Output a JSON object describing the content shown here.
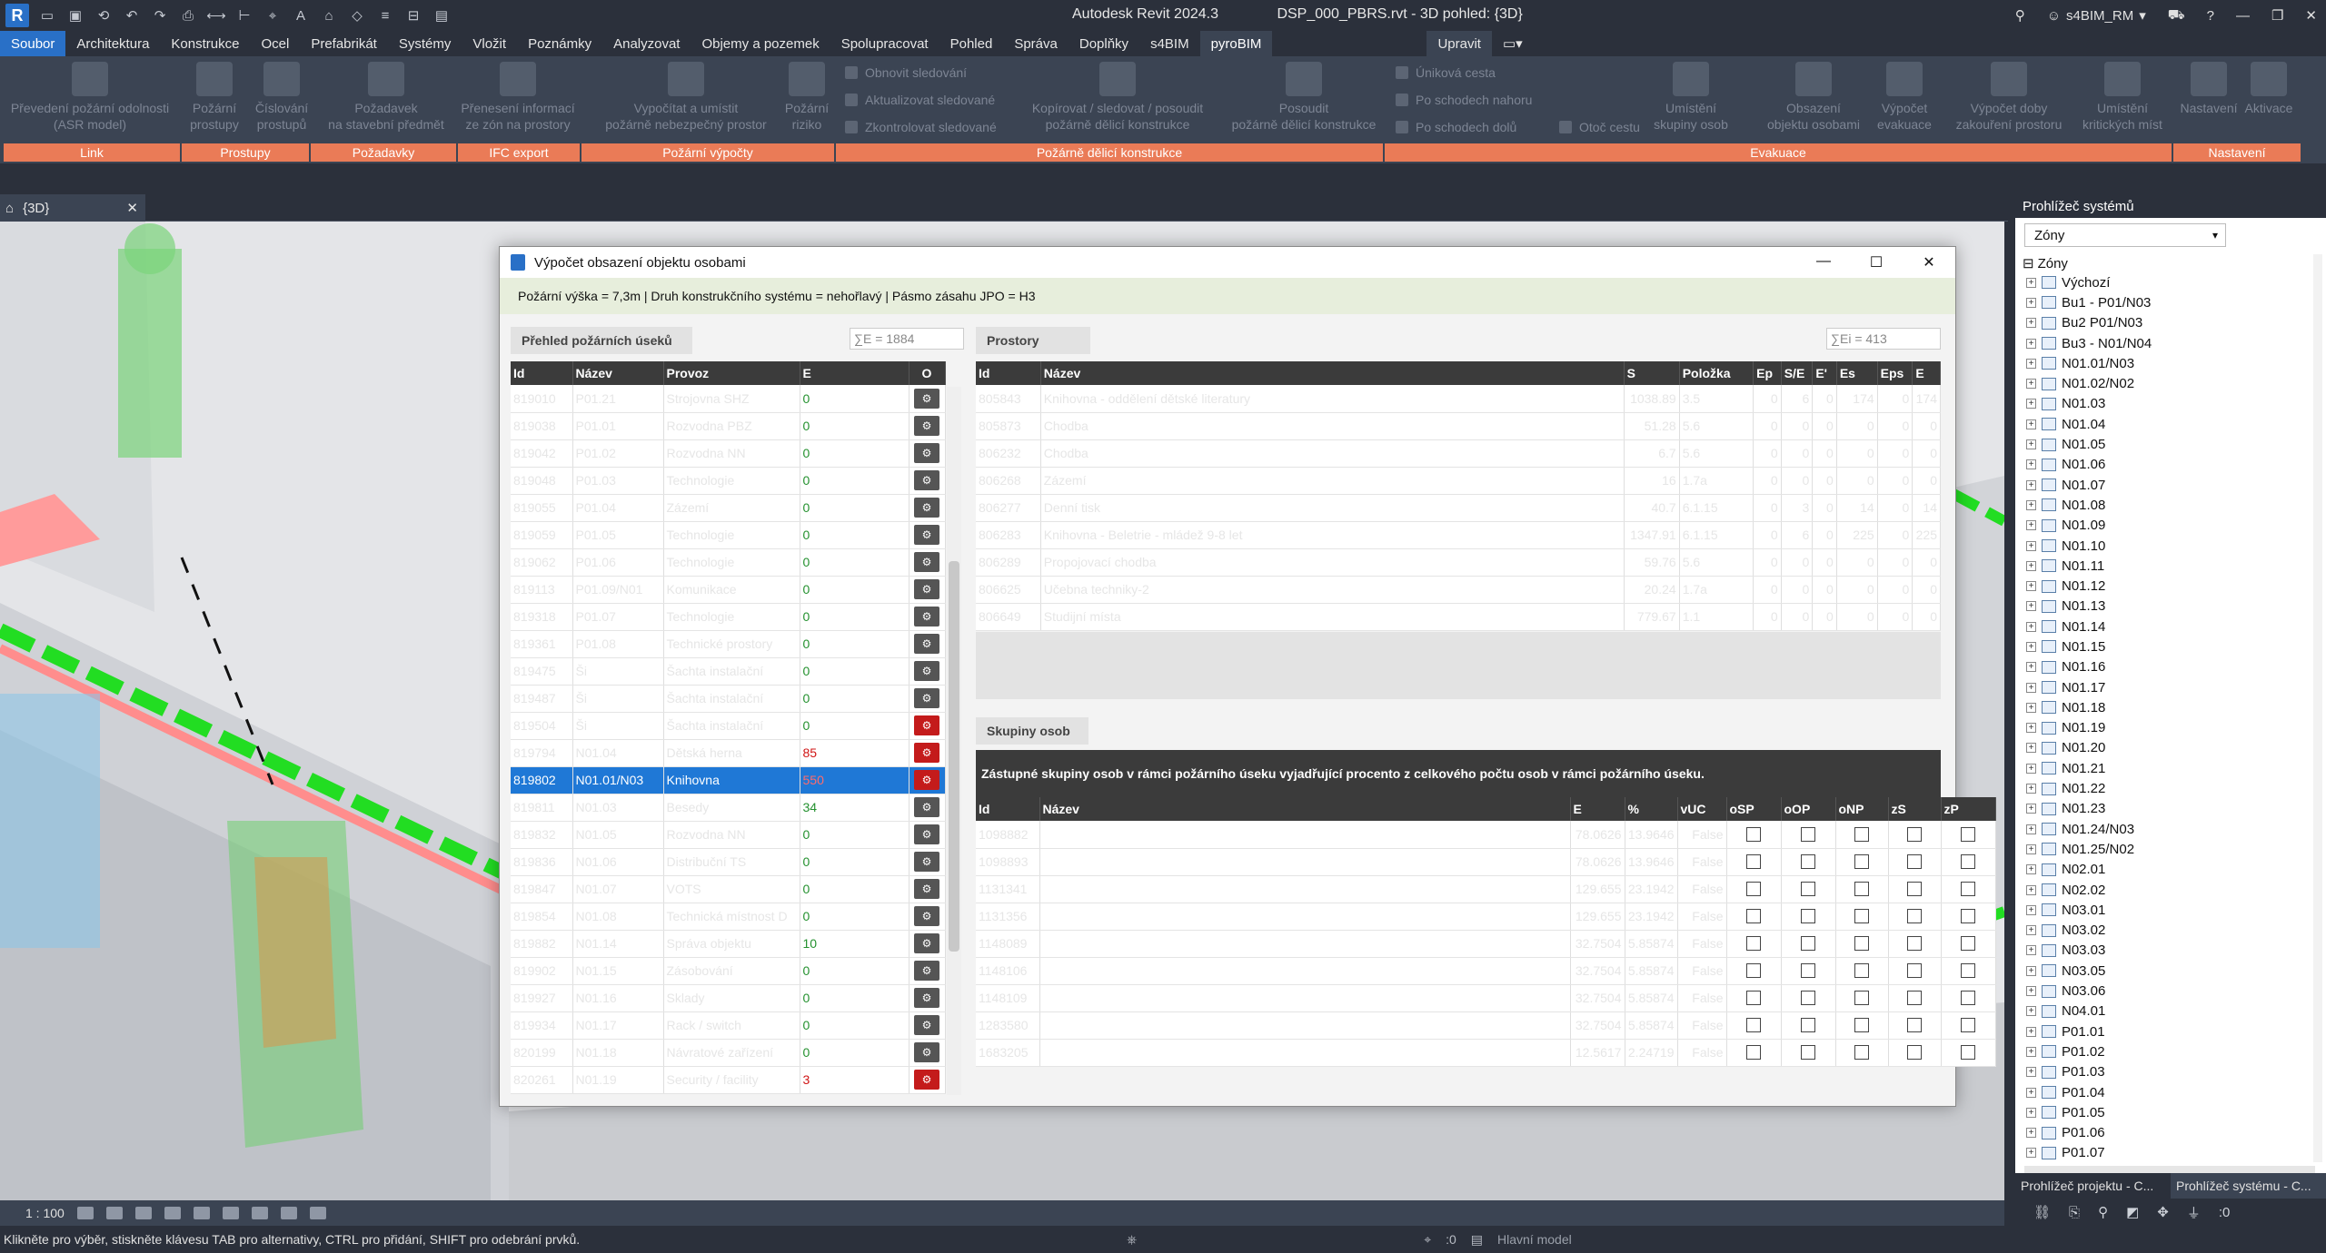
{
  "window": {
    "app_title": "Autodesk Revit 2024.3",
    "doc_title": "DSP_000_PBRS.rvt - 3D pohled: {3D}",
    "user": "s4BIM_RM",
    "logo": "R"
  },
  "ribbon_tabs": [
    "Soubor",
    "Architektura",
    "Konstrukce",
    "Ocel",
    "Prefabrikát",
    "Systémy",
    "Vložit",
    "Poznámky",
    "Analyzovat",
    "Objemy a pozemek",
    "Spolupracovat",
    "Pohled",
    "Správa",
    "Doplňky",
    "s4BIM",
    "pyroBIM"
  ],
  "context_tab": "Upravit",
  "ribbon_buttons": [
    {
      "label": "Převedení požární odolnosti\n(ASR model)"
    },
    {
      "label": "Požární\nprostupy"
    },
    {
      "label": "Číslování\nprostupů"
    },
    {
      "label": "Požadavek\nna stavební předmět"
    },
    {
      "label": "Přenesení informací\nze zón na prostory"
    },
    {
      "label": "Vypočítat a umístit\npožárně nebezpečný prostor"
    },
    {
      "label": "Požární\nriziko"
    },
    {
      "label": "Kopírovat / sledovat / posoudit\npožárně dělicí konstrukce"
    },
    {
      "label": "Posoudit\npožárně dělicí konstrukce"
    },
    {
      "label": "Umístění\nskupiny osob"
    },
    {
      "label": "Obsazení\nobjektu osobami"
    },
    {
      "label": "Výpočet\nevakuace"
    },
    {
      "label": "Výpočet doby\nzakouření prostoru"
    },
    {
      "label": "Umístění\nkritických míst"
    },
    {
      "label": "Nastavení"
    },
    {
      "label": "Aktivace"
    }
  ],
  "ribbon_small": [
    "Obnovit sledování",
    "Aktualizovat sledované",
    "Zkontrolovat sledované",
    "Úniková cesta",
    "Po schodech nahoru",
    "Po schodech dolů",
    "Otoč cestu"
  ],
  "ribbon_panels": [
    "Link",
    "Prostupy",
    "Požadavky",
    "IFC export",
    "Požární výpočty",
    "Požárně dělicí konstrukce",
    "Evakuace",
    "Nastavení"
  ],
  "view_tab": {
    "label": "{3D}",
    "close": "✕"
  },
  "view_bar": {
    "scale": "1 : 100"
  },
  "status_bar": {
    "message": "Klikněte pro výběr, stiskněte klávesu TAB pro alternativy, CTRL pro přidání, SHIFT pro odebrání prvků.",
    "coord": ":0",
    "model": "Hlavní model",
    "filter": ":0"
  },
  "system_browser": {
    "title": "Prohlížeč systémů",
    "selected": "Zóny",
    "root": "Zóny",
    "items": [
      "Výchozí",
      "Bu1 - P01/N03",
      "Bu2 P01/N03",
      "Bu3 - N01/N04",
      "N01.01/N03",
      "N01.02/N02",
      "N01.03",
      "N01.04",
      "N01.05",
      "N01.06",
      "N01.07",
      "N01.08",
      "N01.09",
      "N01.10",
      "N01.11",
      "N01.12",
      "N01.13",
      "N01.14",
      "N01.15",
      "N01.16",
      "N01.17",
      "N01.18",
      "N01.19",
      "N01.20",
      "N01.21",
      "N01.22",
      "N01.23",
      "N01.24/N03",
      "N01.25/N02",
      "N02.01",
      "N02.02",
      "N03.01",
      "N03.02",
      "N03.03",
      "N03.05",
      "N03.06",
      "N04.01",
      "P01.01",
      "P01.02",
      "P01.03",
      "P01.04",
      "P01.05",
      "P01.06",
      "P01.07"
    ],
    "bottom_tabs": [
      "Prohlížeč projektu - C...",
      "Prohlížeč systému - C..."
    ]
  },
  "dialog": {
    "title": "Výpočet obsazení objektu osobami",
    "info": "Požární výška = 7,3m | Druh konstrukčního systému = nehořlavý | Pásmo zásahu JPO = H3",
    "fire_sections": {
      "title": "Přehled požárních úseků",
      "sum": "∑E = 1884",
      "columns": [
        "Id",
        "Název",
        "Provoz",
        "E",
        "O"
      ],
      "rows": [
        {
          "id": "819010",
          "name": "P01.21",
          "use": "Strojovna SHZ",
          "e": "0",
          "flag": "ok"
        },
        {
          "id": "819038",
          "name": "P01.01",
          "use": "Rozvodna PBZ",
          "e": "0",
          "flag": "ok"
        },
        {
          "id": "819042",
          "name": "P01.02",
          "use": "Rozvodna NN",
          "e": "0",
          "flag": "ok"
        },
        {
          "id": "819048",
          "name": "P01.03",
          "use": "Technologie",
          "e": "0",
          "flag": "ok"
        },
        {
          "id": "819055",
          "name": "P01.04",
          "use": "Zázemí",
          "e": "0",
          "flag": "ok"
        },
        {
          "id": "819059",
          "name": "P01.05",
          "use": "Technologie",
          "e": "0",
          "flag": "ok"
        },
        {
          "id": "819062",
          "name": "P01.06",
          "use": "Technologie",
          "e": "0",
          "flag": "ok"
        },
        {
          "id": "819113",
          "name": "P01.09/N01",
          "use": "Komunikace",
          "e": "0",
          "flag": "ok"
        },
        {
          "id": "819318",
          "name": "P01.07",
          "use": "Technologie",
          "e": "0",
          "flag": "ok"
        },
        {
          "id": "819361",
          "name": "P01.08",
          "use": "Technické prostory",
          "e": "0",
          "flag": "ok"
        },
        {
          "id": "819475",
          "name": "Ši",
          "use": "Šachta instalační",
          "e": "0",
          "flag": "ok"
        },
        {
          "id": "819487",
          "name": "Ši",
          "use": "Šachta instalační",
          "e": "0",
          "flag": "ok"
        },
        {
          "id": "819504",
          "name": "Ši",
          "use": "Šachta instalační",
          "e": "0",
          "flag": "warn"
        },
        {
          "id": "819794",
          "name": "N01.04",
          "use": "Dětská herna",
          "e": "85",
          "flag": "warn"
        },
        {
          "id": "819802",
          "name": "N01.01/N03",
          "use": "Knihovna",
          "e": "550",
          "flag": "warn",
          "selected": true
        },
        {
          "id": "819811",
          "name": "N01.03",
          "use": "Besedy",
          "e": "34",
          "flag": "ok"
        },
        {
          "id": "819832",
          "name": "N01.05",
          "use": "Rozvodna NN",
          "e": "0",
          "flag": "ok"
        },
        {
          "id": "819836",
          "name": "N01.06",
          "use": "Distribuční TS",
          "e": "0",
          "flag": "ok"
        },
        {
          "id": "819847",
          "name": "N01.07",
          "use": "VOTS",
          "e": "0",
          "flag": "ok"
        },
        {
          "id": "819854",
          "name": "N01.08",
          "use": "Technická místnost D",
          "e": "0",
          "flag": "ok"
        },
        {
          "id": "819882",
          "name": "N01.14",
          "use": "Správa objektu",
          "e": "10",
          "flag": "ok"
        },
        {
          "id": "819902",
          "name": "N01.15",
          "use": "Zásobování",
          "e": "0",
          "flag": "ok"
        },
        {
          "id": "819927",
          "name": "N01.16",
          "use": "Sklady",
          "e": "0",
          "flag": "ok"
        },
        {
          "id": "819934",
          "name": "N01.17",
          "use": "Rack / switch",
          "e": "0",
          "flag": "ok"
        },
        {
          "id": "820199",
          "name": "N01.18",
          "use": "Návratové zařízení",
          "e": "0",
          "flag": "ok"
        },
        {
          "id": "820261",
          "name": "N01.19",
          "use": "Security / facility",
          "e": "3",
          "flag": "warn"
        }
      ]
    },
    "spaces": {
      "title": "Prostory",
      "sum": "∑Ei = 413",
      "columns": [
        "Id",
        "Název",
        "S",
        "Položka",
        "Ep",
        "S/E",
        "E'",
        "Es",
        "Eps",
        "E"
      ],
      "rows": [
        [
          "805843",
          "Knihovna - oddělení dětské literatury",
          "1038.89",
          "3.5",
          "0",
          "6",
          "0",
          "174",
          "0",
          "174"
        ],
        [
          "805873",
          "Chodba",
          "51.28",
          "5.6",
          "0",
          "0",
          "0",
          "0",
          "0",
          "0"
        ],
        [
          "806232",
          "Chodba",
          "6.7",
          "5.6",
          "0",
          "0",
          "0",
          "0",
          "0",
          "0"
        ],
        [
          "806268",
          "Zázemí",
          "16",
          "1.7a",
          "0",
          "0",
          "0",
          "0",
          "0",
          "0"
        ],
        [
          "806277",
          "Denní tisk",
          "40.7",
          "6.1.15",
          "0",
          "3",
          "0",
          "14",
          "0",
          "14"
        ],
        [
          "806283",
          "Knihovna - Beletrie - mládež 9-8 let",
          "1347.91",
          "6.1.15",
          "0",
          "6",
          "0",
          "225",
          "0",
          "225"
        ],
        [
          "806289",
          "Propojovací chodba",
          "59.76",
          "5.6",
          "0",
          "0",
          "0",
          "0",
          "0",
          "0"
        ],
        [
          "806625",
          "Učebna techniky-2",
          "20.24",
          "1.7a",
          "0",
          "0",
          "0",
          "0",
          "0",
          "0"
        ],
        [
          "806649",
          "Studijní místa",
          "779.67",
          "1.1",
          "0",
          "0",
          "0",
          "0",
          "0",
          "0"
        ]
      ]
    },
    "groups": {
      "title": "Skupiny osob",
      "description": "Zástupné skupiny osob v rámci požárního úseku vyjadřující procento z celkového počtu osob v rámci požárního úseku.",
      "columns": [
        "Id",
        "Název",
        "E",
        "%",
        "vUC",
        "oSP",
        "oOP",
        "oNP",
        "zS",
        "zP"
      ],
      "rows": [
        [
          "1098882",
          "",
          "78.0626",
          "13.9646",
          "False"
        ],
        [
          "1098893",
          "",
          "78.0626",
          "13.9646",
          "False"
        ],
        [
          "1131341",
          "",
          "129.655",
          "23.1942",
          "False"
        ],
        [
          "1131356",
          "",
          "129.655",
          "23.1942",
          "False"
        ],
        [
          "1148089",
          "",
          "32.7504",
          "5.85874",
          "False"
        ],
        [
          "1148106",
          "",
          "32.7504",
          "5.85874",
          "False"
        ],
        [
          "1148109",
          "",
          "32.7504",
          "5.85874",
          "False"
        ],
        [
          "1283580",
          "",
          "32.7504",
          "5.85874",
          "False"
        ],
        [
          "1683205",
          "",
          "12.5617",
          "2.24719",
          "False"
        ]
      ]
    }
  },
  "colors": {
    "accent_blue": "#2970c7",
    "ribbon_panel": "#ea7b57",
    "selection": "#1f78d6",
    "value_green": "#24912f",
    "value_red": "#d01515"
  }
}
